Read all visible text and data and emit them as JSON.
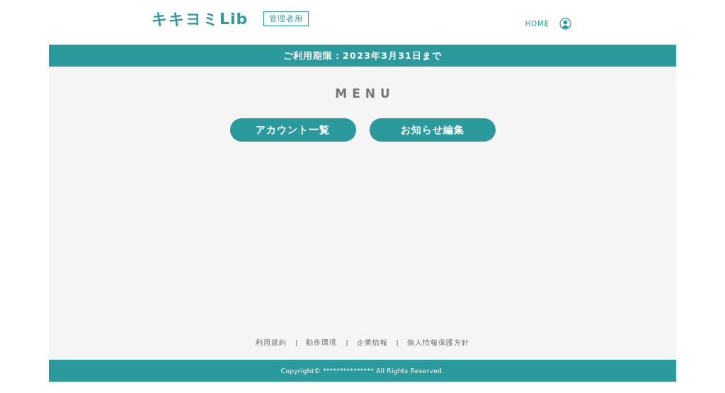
{
  "header": {
    "logo": "キキヨミLib",
    "badge": "管理者用",
    "nav_link": "HOME"
  },
  "notice_bar": {
    "text": "ご利用期限：2023年3月31日まで"
  },
  "menu": {
    "title": "MENU",
    "buttons": [
      "アカウント一覧",
      "お知らせ編集"
    ]
  },
  "footer_links": {
    "separator": "|",
    "links": [
      "利用規約",
      "動作環境",
      "企業情報",
      "個人情報保護方針"
    ]
  },
  "copyright": "Copyright© ***************  All Rights Reserved."
}
